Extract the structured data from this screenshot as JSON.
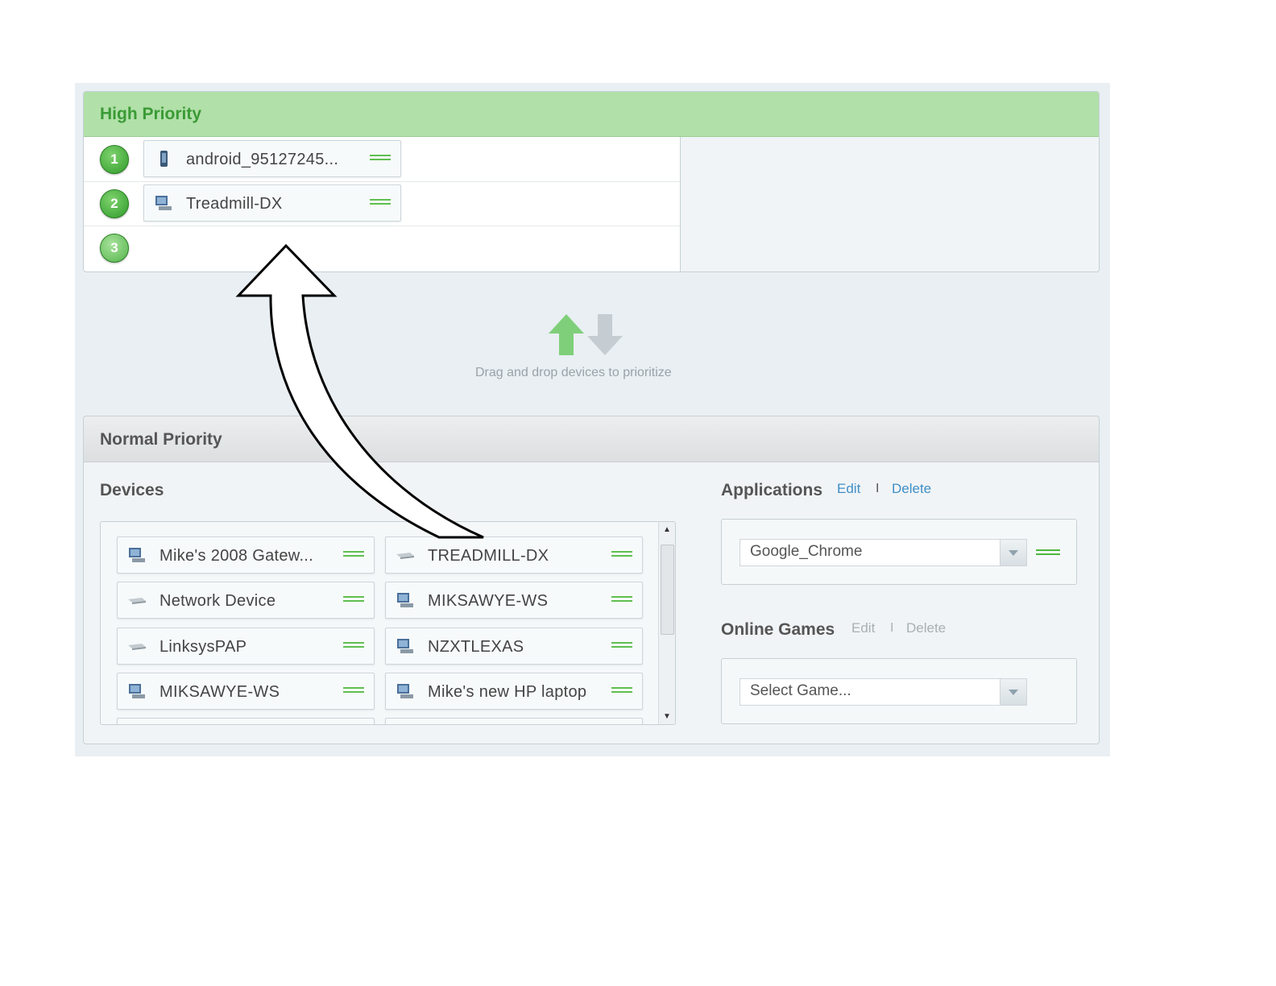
{
  "high_priority": {
    "title": "High Priority",
    "slots": [
      {
        "number": "1",
        "device": "android_95127245...",
        "icon": "phone-icon"
      },
      {
        "number": "2",
        "device": "Treadmill-DX",
        "icon": "computer-icon"
      },
      {
        "number": "3",
        "device": "",
        "icon": ""
      }
    ]
  },
  "drag_hint": "Drag and drop devices to prioritize",
  "normal_priority": {
    "title": "Normal Priority",
    "devices_title": "Devices",
    "devices": [
      {
        "name": "Mike's 2008 Gatew...",
        "icon": "computer-icon"
      },
      {
        "name": "TREADMILL-DX",
        "icon": "network-device-icon"
      },
      {
        "name": "Network Device",
        "icon": "network-device-icon"
      },
      {
        "name": "MIKSAWYE-WS",
        "icon": "computer-icon"
      },
      {
        "name": "LinksysPAP",
        "icon": "network-device-icon"
      },
      {
        "name": "NZXTLEXAS",
        "icon": "computer-icon"
      },
      {
        "name": "MIKSAWYE-WS",
        "icon": "computer-icon"
      },
      {
        "name": "Mike's new HP laptop",
        "icon": "computer-icon"
      }
    ],
    "applications": {
      "title": "Applications",
      "edit": "Edit",
      "sep": "I",
      "delete": "Delete",
      "selected": "Google_Chrome"
    },
    "online_games": {
      "title": "Online Games",
      "edit": "Edit",
      "sep": "I",
      "delete": "Delete",
      "selected": "Select Game..."
    }
  },
  "colors": {
    "high_header": "#b1e0a9",
    "high_title": "#3a9a35",
    "link": "#3f8fc8",
    "grip": "#5fbf4f"
  }
}
